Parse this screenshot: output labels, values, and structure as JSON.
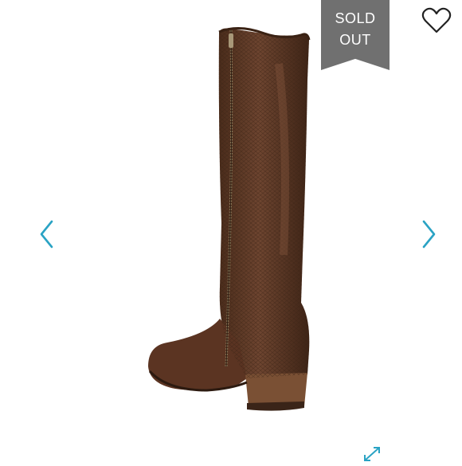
{
  "badge": {
    "line1": "SOLD",
    "line2": "OUT",
    "color": "#707070"
  },
  "icons": {
    "favorite": "heart-icon",
    "previous": "chevron-left-icon",
    "next": "chevron-right-icon",
    "expand": "expand-icon"
  },
  "colors": {
    "accent": "#2aa3c4",
    "background": "#ffffff"
  }
}
